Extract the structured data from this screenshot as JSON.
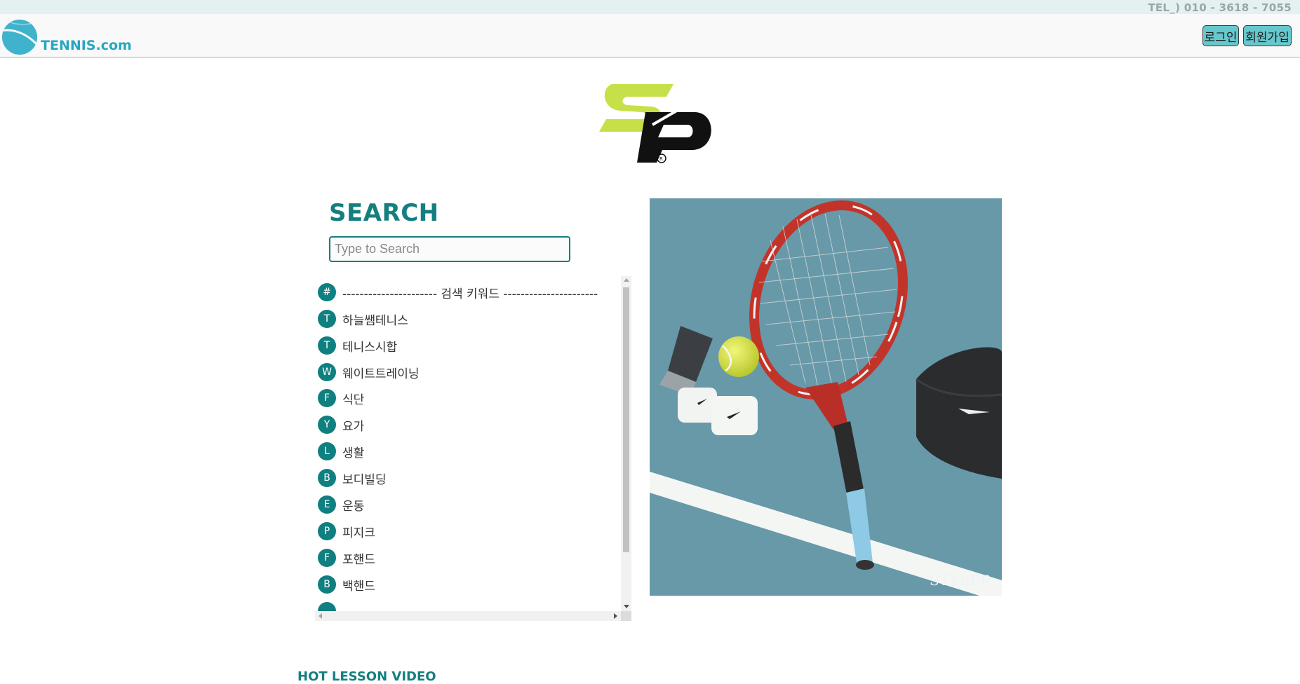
{
  "topbar": {
    "tel": "TEL_) 010 - 3618 - 7055"
  },
  "header": {
    "logo_text": "TENNIS.com",
    "login_label": "로그인",
    "signup_label": "회원가입"
  },
  "brand_logo": {
    "icon": "sp-brand-logo",
    "colors": {
      "lime": "#c6e04a",
      "black": "#111111"
    }
  },
  "search": {
    "title": "SEARCH",
    "placeholder": "Type to Search",
    "value": ""
  },
  "keywords": [
    {
      "badge": "#",
      "label": "---------------------- 검색 키워드 ----------------------"
    },
    {
      "badge": "T",
      "label": "하늘쌤테니스"
    },
    {
      "badge": "T",
      "label": "테니스시합"
    },
    {
      "badge": "W",
      "label": "웨이트트레이닝"
    },
    {
      "badge": "F",
      "label": "식단"
    },
    {
      "badge": "Y",
      "label": "요가"
    },
    {
      "badge": "L",
      "label": "생활"
    },
    {
      "badge": "B",
      "label": "보디빌딩"
    },
    {
      "badge": "E",
      "label": "운동"
    },
    {
      "badge": "P",
      "label": "피지크"
    },
    {
      "badge": "F",
      "label": "포핸드"
    },
    {
      "badge": "B",
      "label": "백핸드"
    },
    {
      "badge": "",
      "label": ""
    }
  ],
  "photo": {
    "watermark": "STYLER"
  },
  "section": {
    "hot_lesson": "HOT LESSON VIDEO"
  },
  "colors": {
    "accent": "#157f80",
    "topbar": "#e3f1f2",
    "button": "#66c7cc",
    "logo": "#24a7c2"
  }
}
